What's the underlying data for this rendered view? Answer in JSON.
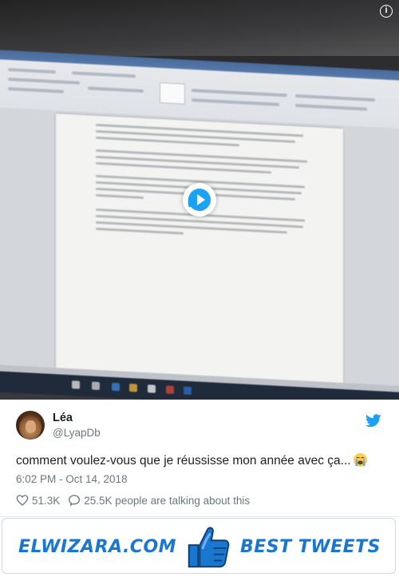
{
  "video": {
    "info_icon": "info-icon",
    "play_icon": "play-icon"
  },
  "tweet": {
    "author_name": "Léa",
    "author_handle": "@LyapDb",
    "text": "comment voulez-vous que je réussisse mon année avec ça...",
    "emoji": "loudly-crying-face-emoji",
    "timestamp": "6:02 PM - Oct 14, 2018",
    "likes": "51.3K",
    "talking": "25.5K people are talking about this",
    "brand_icon": "twitter-bird-icon",
    "colors": {
      "twitter_blue": "#1da1f2",
      "text": "#1c2022",
      "muted": "#697882"
    }
  },
  "footer": {
    "site": "ELWIZARA.COM",
    "tagline": "BEST TWEETS",
    "icon": "thumbs-up-icon",
    "accent": "#1a77cf"
  }
}
